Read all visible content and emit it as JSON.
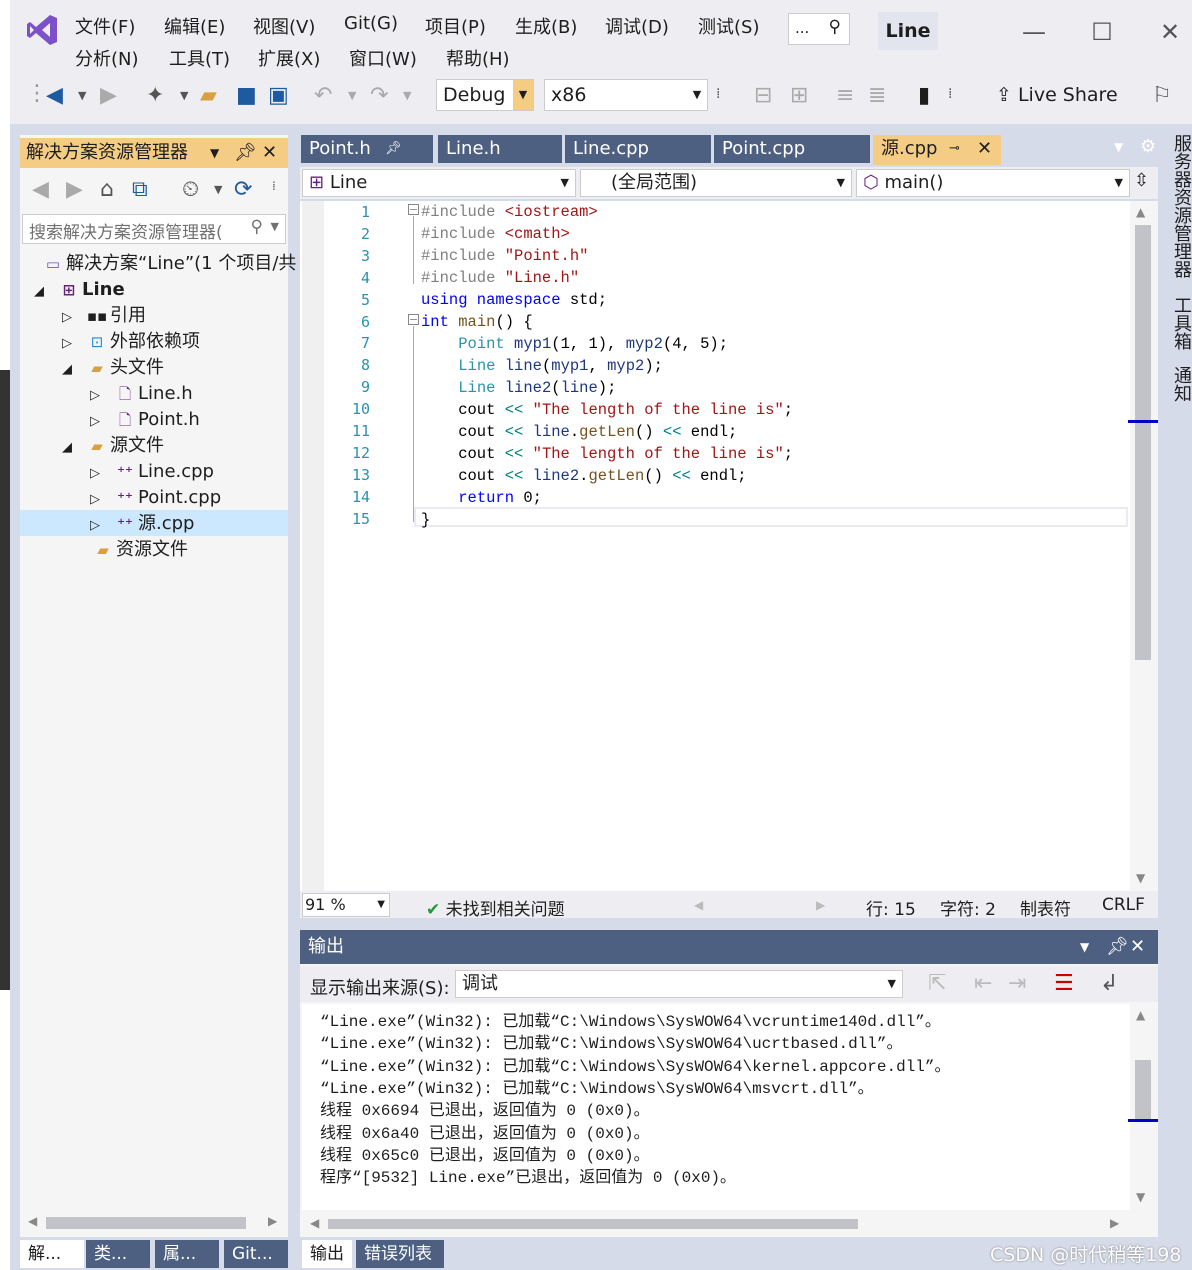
{
  "menu": {
    "file": "文件(F)",
    "edit": "编辑(E)",
    "view": "视图(V)",
    "git": "Git(G)",
    "project": "项目(P)",
    "build": "生成(B)",
    "debug": "调试(D)",
    "test": "测试(S)",
    "analyze": "分析(N)",
    "tools": "工具(T)",
    "extensions": "扩展(X)",
    "window": "窗口(W)",
    "help": "帮助(H)"
  },
  "search": {
    "label": "..."
  },
  "solution_name": "Line",
  "toolbar": {
    "config": "Debug",
    "platform": "x86",
    "live_share": "Live Share"
  },
  "solution_explorer": {
    "title": "解决方案资源管理器",
    "search_placeholder": "搜索解决方案资源管理器(",
    "tree": {
      "solution": "解决方案“Line”(1 个项目/共",
      "project": "Line",
      "references": "引用",
      "external": "外部依赖项",
      "headers": "头文件",
      "line_h": "Line.h",
      "point_h": "Point.h",
      "sources": "源文件",
      "line_cpp": "Line.cpp",
      "point_cpp": "Point.cpp",
      "source_cpp": "源.cpp",
      "resources": "资源文件"
    },
    "bottom_tabs": [
      "解...",
      "类...",
      "属...",
      "Git..."
    ]
  },
  "editor": {
    "tabs": [
      "Point.h",
      "Line.h",
      "Line.cpp",
      "Point.cpp",
      "源.cpp"
    ],
    "nav": {
      "project": "Line",
      "scope": "(全局范围)",
      "member": "main()"
    },
    "line_numbers": [
      "1",
      "2",
      "3",
      "4",
      "5",
      "6",
      "7",
      "8",
      "9",
      "10",
      "11",
      "12",
      "13",
      "14",
      "15"
    ],
    "status": {
      "zoom": "91 %",
      "issues": "未找到相关问题",
      "row": "行: 15",
      "col": "字符: 2",
      "tabs": "制表符",
      "eol": "CRLF"
    }
  },
  "output": {
    "title": "输出",
    "source_label": "显示输出来源(S):",
    "source_value": "调试",
    "lines": [
      "“Line.exe”(Win32): 已加载“C:\\Windows\\SysWOW64\\vcruntime140d.dll”。",
      "“Line.exe”(Win32): 已加载“C:\\Windows\\SysWOW64\\ucrtbased.dll”。",
      "“Line.exe”(Win32): 已加载“C:\\Windows\\SysWOW64\\kernel.appcore.dll”。",
      "“Line.exe”(Win32): 已加载“C:\\Windows\\SysWOW64\\msvcrt.dll”。",
      "线程 0x6694 已退出，返回值为 0 (0x0)。",
      "线程 0x6a40 已退出，返回值为 0 (0x0)。",
      "线程 0x65c0 已退出，返回值为 0 (0x0)。",
      "程序“[9532] Line.exe”已退出，返回值为 0 (0x0)。"
    ],
    "bottom_tabs": [
      "输出",
      "错误列表"
    ]
  },
  "right_side": [
    "服务器资源管理器",
    "工具箱",
    "通知"
  ],
  "watermark": "CSDN @时代稍等198",
  "colors": {
    "accent": "#4d6082",
    "highlight": "#f5cc84",
    "keyword": "#0000ff",
    "type": "#2b91af",
    "string": "#a31515"
  }
}
